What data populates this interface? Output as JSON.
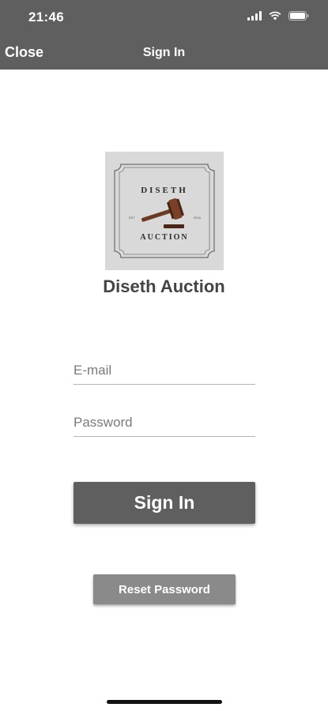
{
  "status_bar": {
    "time": "21:46"
  },
  "nav": {
    "close_label": "Close",
    "title": "Sign In"
  },
  "logo": {
    "line1": "DISETH",
    "line2": "AUCTION",
    "small_left": "EST",
    "small_right": "2018"
  },
  "app_name": "Diseth Auction",
  "form": {
    "email_placeholder": "E-mail",
    "password_placeholder": "Password",
    "signin_label": "Sign In",
    "reset_label": "Reset Password"
  },
  "colors": {
    "nav_bg": "#5f5f5f",
    "primary_button": "#5f5f5f",
    "secondary_button": "#8a8a8a"
  }
}
